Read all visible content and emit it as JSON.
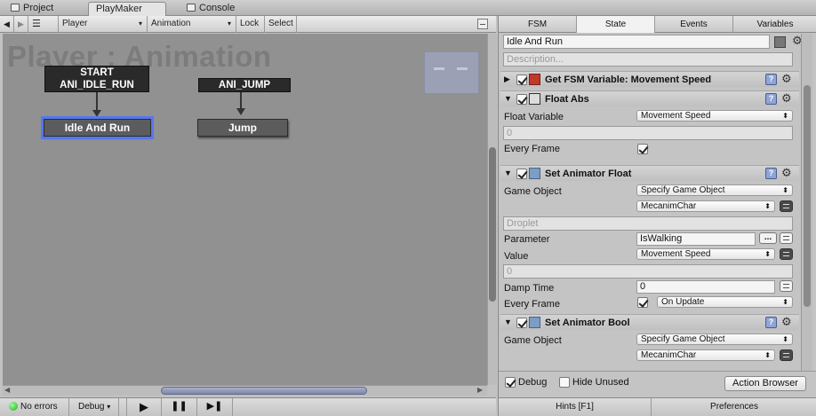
{
  "window_tabs": [
    {
      "label": "Project",
      "active": false
    },
    {
      "label": "PlayMaker",
      "active": true
    },
    {
      "label": "Console",
      "active": false
    }
  ],
  "toolbar": {
    "back": "◀",
    "forward": "▶",
    "menu": "☰",
    "gameobject": "Player",
    "fsm": "Animation",
    "lock": "Lock",
    "select": "Select"
  },
  "canvas": {
    "title": "Player : Animation",
    "start_label": "START",
    "events": [
      {
        "label": "ANI_IDLE_RUN"
      },
      {
        "label": "ANI_JUMP"
      }
    ],
    "states": [
      {
        "label": "Idle And Run",
        "selected": true
      },
      {
        "label": "Jump",
        "selected": false
      }
    ]
  },
  "statusbar": {
    "errors": "No errors",
    "debug": "Debug",
    "play": "▶",
    "pause": "❚❚",
    "step": "▶❚"
  },
  "inspector": {
    "tabs": [
      {
        "label": "FSM",
        "active": false
      },
      {
        "label": "State",
        "active": true
      },
      {
        "label": "Events",
        "active": false
      },
      {
        "label": "Variables",
        "active": false
      }
    ],
    "state_name": "Idle And Run",
    "description_placeholder": "Description...",
    "actions": [
      {
        "title": "Get FSM Variable: Movement Speed",
        "expanded": false,
        "enabled": true
      },
      {
        "title": "Float Abs",
        "expanded": true,
        "enabled": true,
        "float_variable_label": "Float Variable",
        "float_variable_value": "Movement Speed",
        "float_value": "0",
        "every_frame_label": "Every Frame",
        "every_frame": true
      },
      {
        "title": "Set Animator Float",
        "expanded": true,
        "enabled": true,
        "game_object_label": "Game Object",
        "game_object_mode": "Specify Game Object",
        "game_object_value": "MecanimChar",
        "droplet_placeholder": "Droplet",
        "parameter_label": "Parameter",
        "parameter_value": "IsWalking",
        "parameter_more": "...",
        "value_label": "Value",
        "value_value": "Movement Speed",
        "value_number": "0",
        "damp_time_label": "Damp Time",
        "damp_time_value": "0",
        "every_frame_label": "Every Frame",
        "every_frame": true,
        "every_frame_mode": "On Update"
      },
      {
        "title": "Set Animator Bool",
        "expanded": true,
        "enabled": true,
        "game_object_label": "Game Object",
        "game_object_mode": "Specify Game Object",
        "game_object_value": "MecanimChar"
      }
    ],
    "bottom": {
      "debug_label": "Debug",
      "debug": true,
      "hide_unused_label": "Hide Unused",
      "hide_unused": false,
      "action_browser": "Action Browser"
    },
    "footer": {
      "hints": "Hints [F1]",
      "preferences": "Preferences"
    }
  },
  "colors": {
    "canvas_bg": "#919191",
    "selected_outline": "#5577ee",
    "event_bg": "#2a2a2a",
    "state_bg": "#5c5c5c"
  }
}
